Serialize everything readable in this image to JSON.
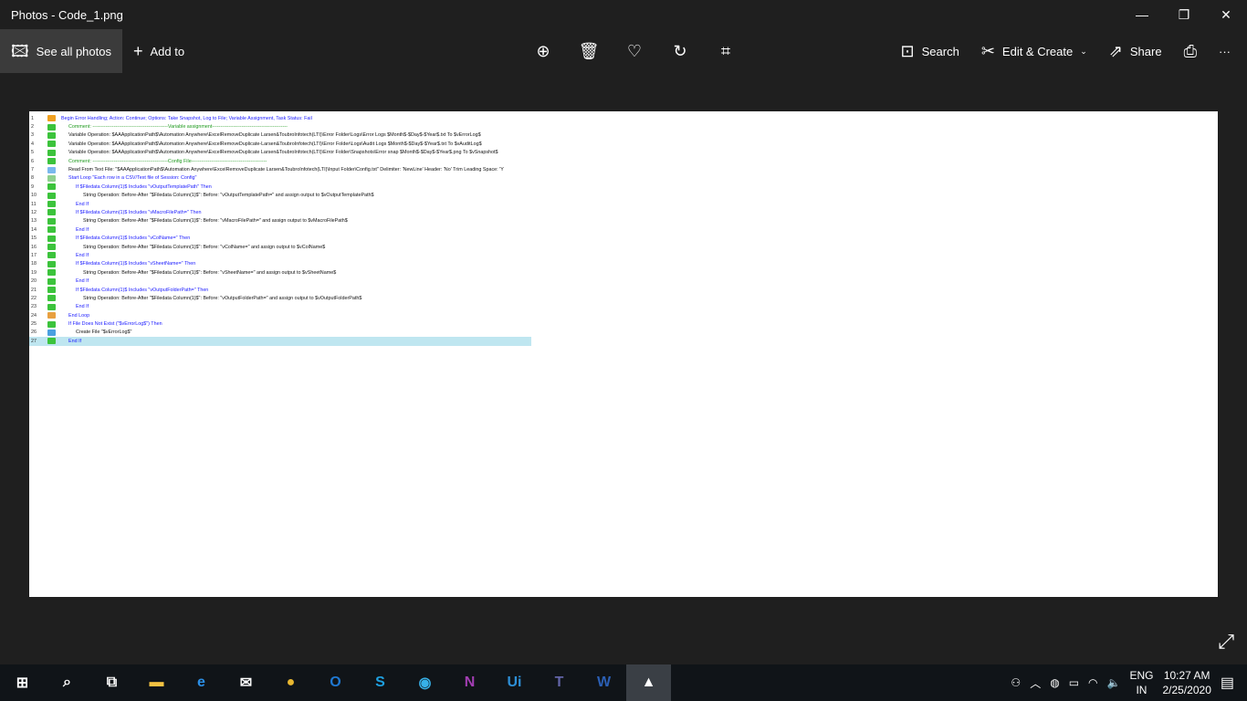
{
  "window": {
    "title": "Photos - Code_1.png",
    "minimize": "—",
    "maximize": "❐",
    "close": "✕"
  },
  "toolbar": {
    "see_all": "See all photos",
    "add_to": "Add to",
    "search": "Search",
    "edit_create": "Edit & Create",
    "share": "Share",
    "more": "···",
    "icons": [
      "zoom-icon",
      "delete-icon",
      "favorite-icon",
      "rotate-icon",
      "crop-icon",
      "print-icon"
    ]
  },
  "code": [
    {
      "n": "1",
      "t": "Begin Error Handling; Action: Continue; Options: Take Snapshot, Log to File; Variable Assignment,  Task Status: Fail",
      "c": "blue",
      "i": 0,
      "ic": "#f0a020"
    },
    {
      "n": "2",
      "t": "Comment: ----------------------------------------------Variable assignment----------------------------------------------",
      "c": "green",
      "i": 1,
      "ic": "#3cc33c"
    },
    {
      "n": "3",
      "t": "Variable Operation: $AAApplicationPath$\\Automation Anywhere\\ExcelRemoveDuplicate Larsen&ToubroInfotech(LTI)\\Error Folder\\Logs\\Error Logs $Month$-$Day$-$Year$.txt To $vErrorLog$",
      "c": "",
      "i": 1,
      "ic": "#3cc33c"
    },
    {
      "n": "4",
      "t": "Variable Operation: $AAApplicationPath$\\Automation Anywhere\\ExcelRemoveDuplicate-Larsen&ToubroInfotech(LTI)\\Error Folder\\Logs\\Audit Logs $Month$-$Day$-$Year$.txt To $vAuditLog$",
      "c": "",
      "i": 1,
      "ic": "#3cc33c"
    },
    {
      "n": "5",
      "t": "Variable Operation: $AAApplicationPath$\\Automation Anywhere\\ExcelRemoveDuplicate Larsen&ToubroInfotech(LTI)\\Error Folder\\Snapshots\\Error snap $Month$-$Day$-$Year$.png To $vSnapshot$",
      "c": "",
      "i": 1,
      "ic": "#3cc33c"
    },
    {
      "n": "6",
      "t": "Comment: ----------------------------------------------Config File----------------------------------------------",
      "c": "green",
      "i": 1,
      "ic": "#3cc33c"
    },
    {
      "n": "7",
      "t": "Read From Text File: \"$AAApplicationPath$\\Automation Anywhere\\ExcelRemoveDuplicate Larsen&ToubroInfotech(LTI)\\Input Folder\\Config.txt\" Delimiter: 'NewLine' Header: 'No' Trim Leading Space: 'Y",
      "c": "",
      "i": 1,
      "ic": "#7ab8ee"
    },
    {
      "n": "8",
      "t": "Start Loop \"Each row in a CSV/Text file of Session: Config\"",
      "c": "blue",
      "i": 1,
      "ic": "#8fd08f"
    },
    {
      "n": "9",
      "t": "If $Filedata Column(1)$ Includes \"vOutputTemplatePath\" Then",
      "c": "blue",
      "i": 2,
      "ic": "#3cc33c"
    },
    {
      "n": "10",
      "t": "String Operation: Before-After \"$Filedata Column(1)$\": Before: \"vOutputTemplatePath=\" and assign output to $vOutputTemplatePath$",
      "c": "",
      "i": 3,
      "ic": "#3cc33c"
    },
    {
      "n": "11",
      "t": "End If",
      "c": "blue",
      "i": 2,
      "ic": "#3cc33c"
    },
    {
      "n": "12",
      "t": "If $Filedata Column(1)$ Includes \"vMacroFilePath=\" Then",
      "c": "blue",
      "i": 2,
      "ic": "#3cc33c"
    },
    {
      "n": "13",
      "t": "String Operation: Before-After \"$Filedata Column(1)$\": Before: \"vMacroFilePath=\" and assign output to $vMacroFilePath$",
      "c": "",
      "i": 3,
      "ic": "#3cc33c"
    },
    {
      "n": "14",
      "t": "End If",
      "c": "blue",
      "i": 2,
      "ic": "#3cc33c"
    },
    {
      "n": "15",
      "t": "If $Filedata Column(1)$ Includes \"vColName=\" Then",
      "c": "blue",
      "i": 2,
      "ic": "#3cc33c"
    },
    {
      "n": "16",
      "t": "String Operation: Before-After \"$Filedata Column(1)$\": Before: \"vColName=\" and assign output to $vColName$",
      "c": "",
      "i": 3,
      "ic": "#3cc33c"
    },
    {
      "n": "17",
      "t": "End If",
      "c": "blue",
      "i": 2,
      "ic": "#3cc33c"
    },
    {
      "n": "18",
      "t": "If $Filedata Column(1)$ Includes \"vSheetName=\" Then",
      "c": "blue",
      "i": 2,
      "ic": "#3cc33c"
    },
    {
      "n": "19",
      "t": "String Operation: Before-After \"$Filedata Column(1)$\": Before: \"vSheetName=\" and assign output to $vSheetName$",
      "c": "",
      "i": 3,
      "ic": "#3cc33c"
    },
    {
      "n": "20",
      "t": "End If",
      "c": "blue",
      "i": 2,
      "ic": "#3cc33c"
    },
    {
      "n": "21",
      "t": "If $Filedata Column(1)$ Includes \"vOutputFolderPath=\" Then",
      "c": "blue",
      "i": 2,
      "ic": "#3cc33c"
    },
    {
      "n": "22",
      "t": "String Operation: Before-After \"$Filedata Column(1)$\": Before: \"vOutputFolderPath=\" and assign output to $vOutputFolderPath$",
      "c": "",
      "i": 3,
      "ic": "#3cc33c"
    },
    {
      "n": "23",
      "t": "End If",
      "c": "blue",
      "i": 2,
      "ic": "#3cc33c"
    },
    {
      "n": "24",
      "t": "End Loop",
      "c": "blue",
      "i": 1,
      "ic": "#e8a040"
    },
    {
      "n": "25",
      "t": "If File Does Not Exist (\"$vErrorLog$\") Then",
      "c": "blue",
      "i": 1,
      "ic": "#3cc33c"
    },
    {
      "n": "26",
      "t": "Create File \"$vErrorLog$\"",
      "c": "",
      "i": 2,
      "ic": "#4aa0e0"
    },
    {
      "n": "27",
      "t": "End If",
      "c": "blue",
      "i": 1,
      "ic": "#3cc33c",
      "hl": true
    }
  ],
  "taskbar": {
    "apps": [
      {
        "name": "start",
        "g": "⊞",
        "c": "#fff"
      },
      {
        "name": "search",
        "g": "⌕",
        "c": "#fff"
      },
      {
        "name": "task-view",
        "g": "⧉",
        "c": "#fff"
      },
      {
        "name": "file-explorer",
        "g": "▬",
        "c": "#f5c242"
      },
      {
        "name": "edge",
        "g": "e",
        "c": "#2b8fe6"
      },
      {
        "name": "mail",
        "g": "✉",
        "c": "#fff"
      },
      {
        "name": "chrome",
        "g": "●",
        "c": "#e8b730"
      },
      {
        "name": "outlook",
        "g": "O",
        "c": "#1f78d1"
      },
      {
        "name": "skype",
        "g": "S",
        "c": "#1ea0e0"
      },
      {
        "name": "browser",
        "g": "◉",
        "c": "#37b1e8"
      },
      {
        "name": "onenote",
        "g": "N",
        "c": "#a33eb3"
      },
      {
        "name": "uipath",
        "g": "Ui",
        "c": "#2d8fd6"
      },
      {
        "name": "teams",
        "g": "T",
        "c": "#6264a7"
      },
      {
        "name": "word",
        "g": "W",
        "c": "#2b5fb4"
      },
      {
        "name": "photos",
        "g": "▲",
        "c": "#fff",
        "active": true
      }
    ],
    "lang": "ENG",
    "region": "IN",
    "time": "10:27 AM",
    "date": "2/25/2020"
  }
}
